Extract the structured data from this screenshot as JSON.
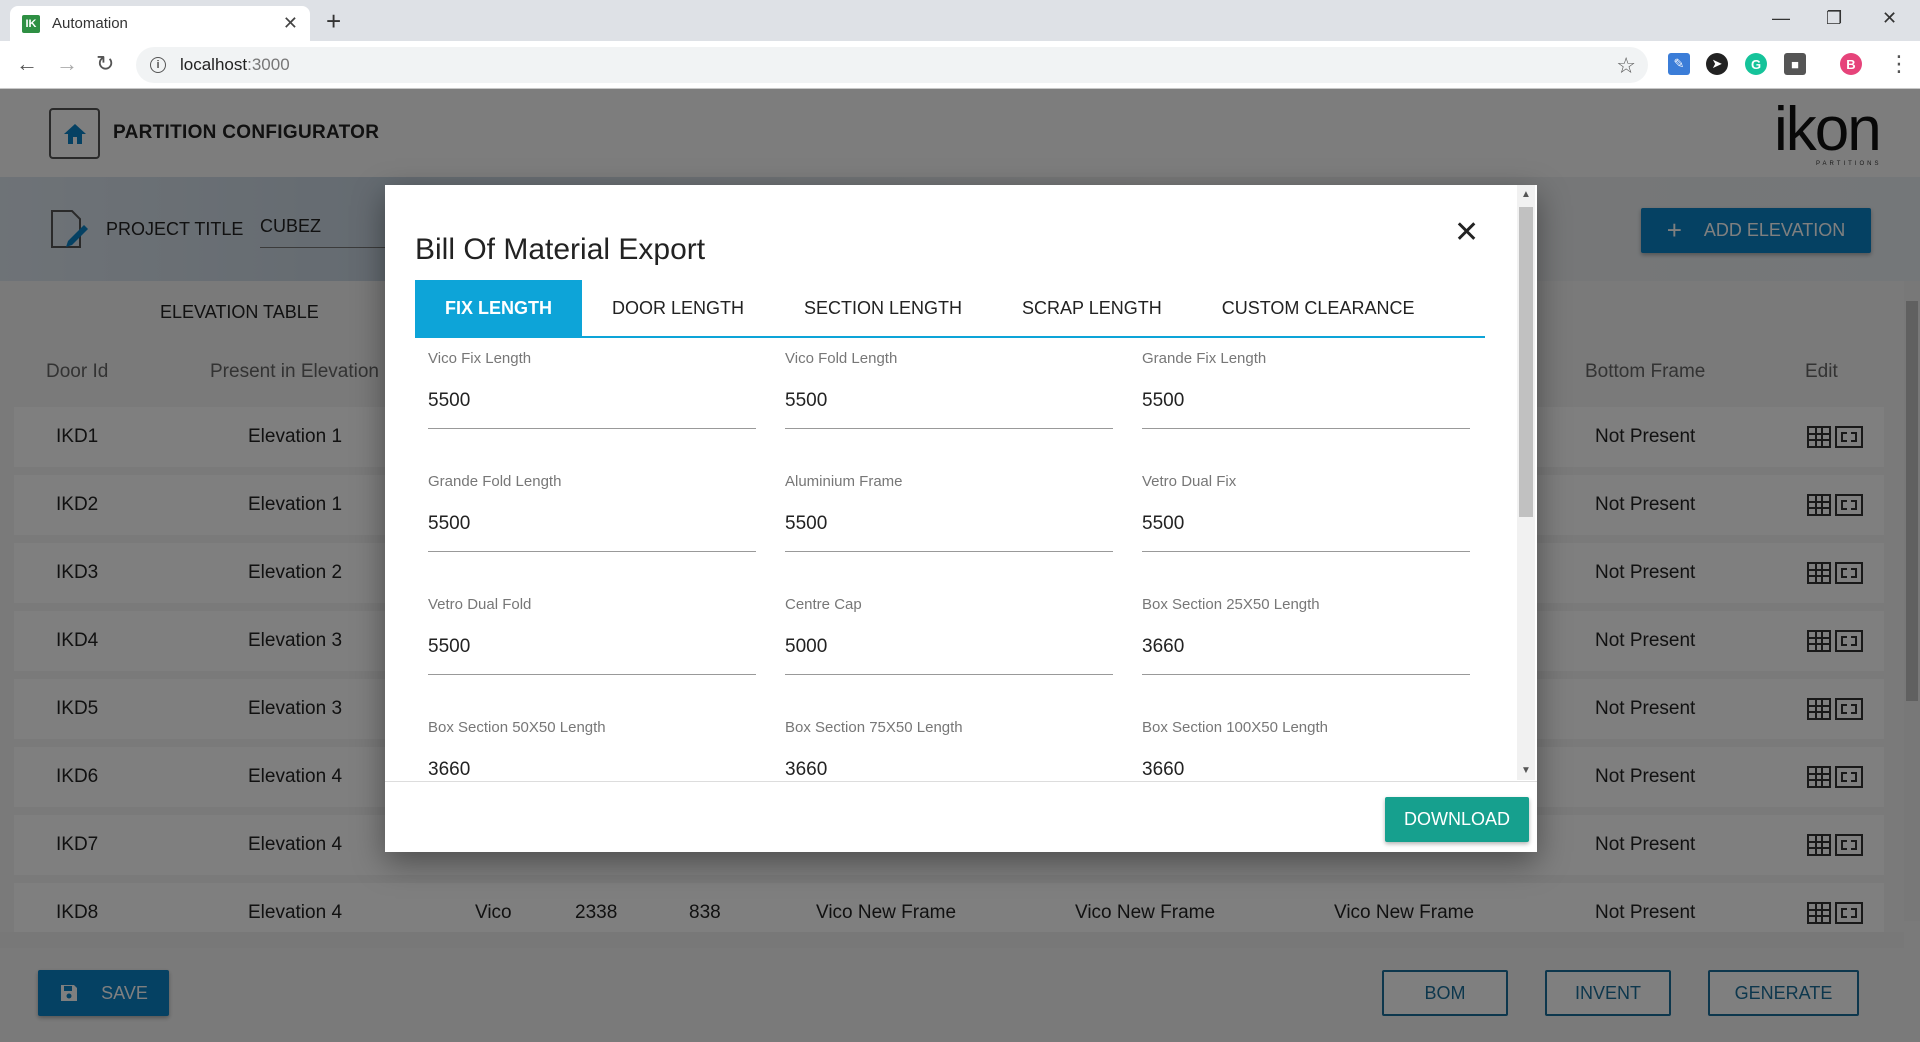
{
  "browser": {
    "tab_title": "Automation",
    "favicon": "IK",
    "url_host": "localhost",
    "url_port": ":3000",
    "profile_initial": "B"
  },
  "app": {
    "title": "PARTITION CONFIGURATOR",
    "logo": "ikon",
    "logo_sub": "PARTITIONS",
    "project_label": "PROJECT TITLE",
    "project_value": "CUBEZ",
    "add_elevation": "ADD ELEVATION",
    "elevation_table_title": "ELEVATION TABLE",
    "headers": {
      "door_id": "Door Id",
      "present_in": "Present in Elevation",
      "bottom_frame": "Bottom Frame",
      "edit": "Edit"
    },
    "rows": [
      {
        "id": "IKD1",
        "elevation": "Elevation 1",
        "bottom": "Not Present"
      },
      {
        "id": "IKD2",
        "elevation": "Elevation 1",
        "bottom": "Not Present"
      },
      {
        "id": "IKD3",
        "elevation": "Elevation 2",
        "bottom": "Not Present"
      },
      {
        "id": "IKD4",
        "elevation": "Elevation 3",
        "bottom": "Not Present"
      },
      {
        "id": "IKD5",
        "elevation": "Elevation 3",
        "bottom": "Not Present"
      },
      {
        "id": "IKD6",
        "elevation": "Elevation 4",
        "bottom": "Not Present"
      },
      {
        "id": "IKD7",
        "elevation": "Elevation 4",
        "bottom": "Not Present"
      },
      {
        "id": "IKD8",
        "elevation": "Elevation 4",
        "bottom": "Not Present",
        "type": "Vico",
        "height": "2338",
        "width": "838",
        "frame1": "Vico New Frame",
        "frame2": "Vico New Frame",
        "frame3": "Vico New Frame"
      }
    ],
    "save": "SAVE",
    "bom": "BOM",
    "invent": "INVENT",
    "generate": "GENERATE"
  },
  "modal": {
    "title": "Bill Of Material Export",
    "tabs": [
      "FIX LENGTH",
      "DOOR LENGTH",
      "SECTION LENGTH",
      "SCRAP LENGTH",
      "CUSTOM CLEARANCE"
    ],
    "active_tab": "FIX LENGTH",
    "fields": [
      {
        "label": "Vico Fix Length",
        "value": "5500"
      },
      {
        "label": "Vico Fold Length",
        "value": "5500"
      },
      {
        "label": "Grande Fix Length",
        "value": "5500"
      },
      {
        "label": "Grande Fold Length",
        "value": "5500"
      },
      {
        "label": "Aluminium Frame",
        "value": "5500"
      },
      {
        "label": "Vetro Dual Fix",
        "value": "5500"
      },
      {
        "label": "Vetro Dual Fold",
        "value": "5500"
      },
      {
        "label": "Centre Cap",
        "value": "5000"
      },
      {
        "label": "Box Section 25X50 Length",
        "value": "3660"
      },
      {
        "label": "Box Section 50X50 Length",
        "value": "3660"
      },
      {
        "label": "Box Section 75X50 Length",
        "value": "3660"
      },
      {
        "label": "Box Section 100X50 Length",
        "value": "3660"
      }
    ],
    "download": "DOWNLOAD"
  },
  "colors": {
    "primary": "#0b82c6",
    "tab_active": "#0da4d8",
    "download": "#16a08e"
  }
}
